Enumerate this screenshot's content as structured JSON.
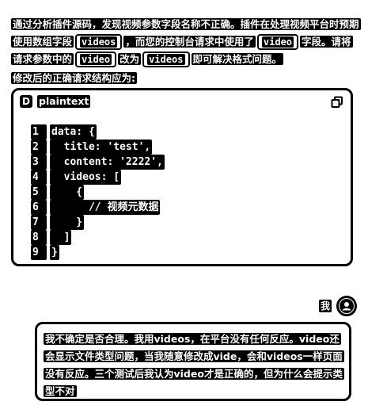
{
  "assistant": {
    "para1": {
      "s1": "通过分析插件源码，发现视频参数字段名称不正确。插件在处理视频平台时预期使用数组字段",
      "code1": "videos",
      "s2": "，而您的控制台请求中使用了",
      "code2": "video",
      "s3": "字段。请将请求参数中的",
      "code3": "video",
      "s4": "改为",
      "code4": "videos",
      "s5": "即可解决格式问题。"
    },
    "subhead": "修改后的正确请求结构应为:",
    "code_block": {
      "language": "plaintext",
      "logo_letter": "D",
      "copy_icon": "copy-icon",
      "lines": [
        {
          "n": "1",
          "text": "data: {"
        },
        {
          "n": "2",
          "text": "  title: 'test',"
        },
        {
          "n": "3",
          "text": "  content: '2222',"
        },
        {
          "n": "4",
          "text": "  videos: ["
        },
        {
          "n": "5",
          "text": "    {"
        },
        {
          "n": "6",
          "text": "      // 视频元数据"
        },
        {
          "n": "7",
          "text": "    }"
        },
        {
          "n": "8",
          "text": "  ]"
        },
        {
          "n": "9",
          "text": "}"
        }
      ]
    }
  },
  "user": {
    "name": "我",
    "avatar_icon": "user-avatar-icon",
    "message": "我不确定是否合理。我用videos，在平台没有任何反应。video还会显示文件类型问题，当我随意修改成vide，会和videos一样页面没有反应。三个测试后我认为video才是正确的，但为什么会提示类型不对"
  }
}
